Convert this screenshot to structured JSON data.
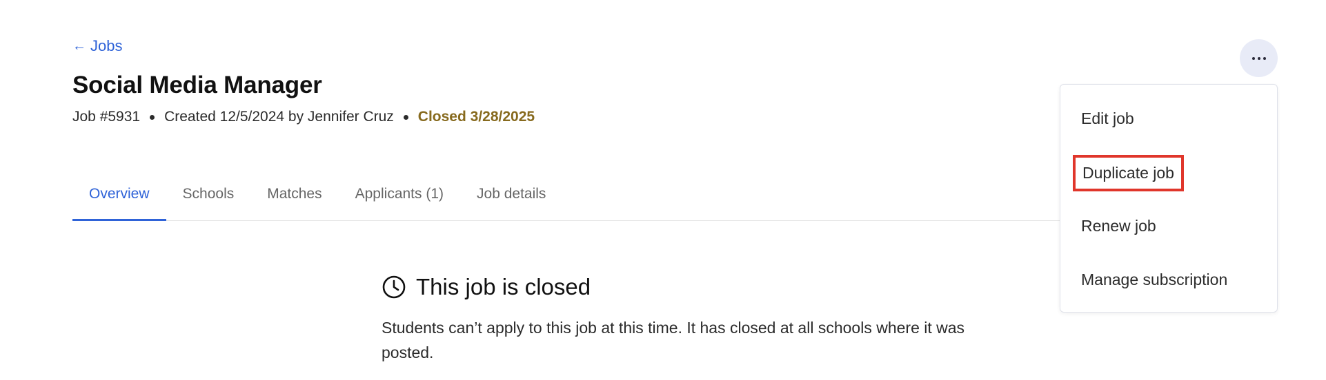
{
  "back_link": {
    "arrow": "←",
    "label": "Jobs"
  },
  "job": {
    "title": "Social Media Manager",
    "number": "Job #5931",
    "created": "Created 12/5/2024 by Jennifer Cruz",
    "status": "Closed 3/28/2025",
    "status_color": "#876a1e"
  },
  "tabs": [
    {
      "label": "Overview",
      "active": true
    },
    {
      "label": "Schools"
    },
    {
      "label": "Matches"
    },
    {
      "label": "Applicants (1)"
    },
    {
      "label": "Job details"
    }
  ],
  "notice": {
    "icon": "clock-icon",
    "heading": "This job is closed",
    "body": "Students can’t apply to this job at this time. It has closed at all schools where it was posted."
  },
  "menu": {
    "trigger_icon": "more-horizontal-icon",
    "items": [
      {
        "label": "Edit job"
      },
      {
        "label": "Duplicate job",
        "highlighted": true
      },
      {
        "label": "Renew job"
      },
      {
        "label": "Manage subscription"
      }
    ]
  },
  "colors": {
    "accent": "#2f63d8",
    "highlight_border": "#e0362b",
    "menu_button_bg": "#e8ebf7"
  }
}
